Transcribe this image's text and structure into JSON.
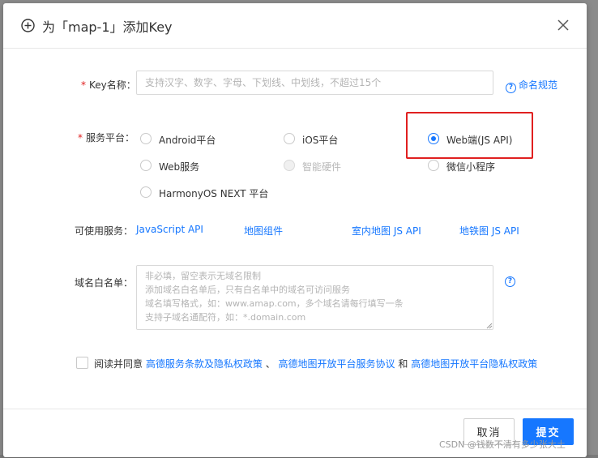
{
  "dialog": {
    "title": "为「map-1」添加Key",
    "close_icon": "close-icon",
    "title_icon": "plus-circle-icon"
  },
  "key_name": {
    "label": "Key名称：",
    "required_mark": "*",
    "placeholder": "支持汉字、数字、字母、下划线、中划线，不超过15个",
    "value": "",
    "help_link": "命名规范"
  },
  "platform": {
    "label": "服务平台：",
    "required_mark": "*",
    "options": [
      {
        "label": "Android平台",
        "checked": false,
        "disabled": false
      },
      {
        "label": "iOS平台",
        "checked": false,
        "disabled": false
      },
      {
        "label": "Web端(JS API)",
        "checked": true,
        "disabled": false
      },
      {
        "label": "Web服务",
        "checked": false,
        "disabled": false
      },
      {
        "label": "智能硬件",
        "checked": false,
        "disabled": true
      },
      {
        "label": "微信小程序",
        "checked": false,
        "disabled": false
      },
      {
        "label": "HarmonyOS NEXT 平台",
        "checked": false,
        "disabled": false
      }
    ],
    "highlight_color": "#e02020"
  },
  "services": {
    "label": "可使用服务：",
    "items": [
      "JavaScript API",
      "地图组件",
      "室内地图 JS API",
      "地铁图 JS API"
    ]
  },
  "whitelist": {
    "label": "域名白名单：",
    "placeholder": "非必填，留空表示无域名限制\n添加域名白名单后，只有白名单中的域名可访问服务\n域名填写格式，如：www.amap.com，多个域名请每行填写一条\n支持子域名通配符，如：*.domain.com",
    "value": ""
  },
  "agreement": {
    "checked": false,
    "prefix": "阅读并同意",
    "link1": "高德服务条款及隐私权政策",
    "sep1": "、",
    "link2": "高德地图开放平台服务协议",
    "sep2": "和",
    "link3": "高德地图开放平台隐私权政策"
  },
  "footer": {
    "cancel_label": "取消",
    "submit_label": "提交"
  },
  "watermark": "CSDN @钱数不清有多少张大土",
  "colors": {
    "accent": "#1677ff",
    "required": "#e02020",
    "overlay": "#7a7a7a"
  }
}
